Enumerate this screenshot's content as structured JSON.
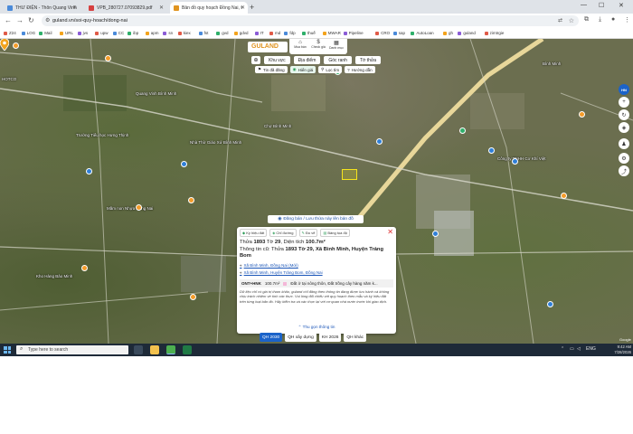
{
  "browser": {
    "tabs": [
      {
        "title": "THƯ ĐIỆN - Thôn Quang Vinh",
        "active": false
      },
      {
        "title": "VPB_280727.07093829.pdf",
        "active": false
      },
      {
        "title": "Bản đồ quy hoạch Đồng Nai, t",
        "active": true
      }
    ],
    "url": "guland.vn/soi-quy-hoach/dong-nai",
    "bookmarks": [
      "Z24",
      "LOG",
      "Mail",
      "URL",
      "jvs",
      "upw",
      "CC",
      "ibp",
      "apm",
      "sn",
      "kiex",
      "fst",
      "gvd",
      "gdvd",
      "IT",
      "md",
      "fdp",
      "thuế",
      "MWAR",
      "Pipeline",
      "CRO",
      "sap",
      "AutoLoan",
      "gh",
      "guland",
      "zimtrgie"
    ]
  },
  "map": {
    "brand": "GULAND",
    "top_icons": [
      {
        "icon": "house-icon",
        "label": "Mua bán"
      },
      {
        "icon": "dollar-icon",
        "label": "Check giá"
      },
      {
        "icon": "grid-icon",
        "label": "Danh mục"
      }
    ],
    "filters1": [
      "Khu vực",
      "Địa điểm",
      "Góc ranh",
      "Tờ thửa"
    ],
    "filters2": [
      "Tin đã đăng",
      "Hiển giá",
      "Lọc tìm",
      "Hướng dẫn"
    ],
    "places": [
      "Trường Tiểu học Hưng Thịnh",
      "Mầm non Nhựa Đồng Nai",
      "Nhà Thờ Giáo Xứ Bình Minh",
      "Chợ Bình Minh",
      "Công ty TNHH Cơ Khí Việt",
      "Quang Vinh Bình Minh",
      "Kho Hàng Bảo Minh",
      "HOTCO",
      "Bình Minh"
    ],
    "register_button": "Đăng bán / Lưu thửa này lên bản đồ",
    "bottom_tabs": [
      "QH 2030",
      "QH xây dựng",
      "KH 2026",
      "QH khác"
    ],
    "active_bottom_tab": "QH 2030",
    "google_mark": "Google"
  },
  "parcel_card": {
    "chips": [
      "Ký hiệu đất",
      "Chỉ đường",
      "Đo vẽ",
      "Bảng tọa độ"
    ],
    "line1_prefix": "Thửa ",
    "parcel_no": "1893",
    "line1_mid": " Tờ ",
    "sheet_no": "29",
    "line1_area_label": ", Diện tích ",
    "area": "100.7m²",
    "line2_prefix": "Thông tin cũ: Thửa ",
    "line2_rest": " Tờ 29, Xã Bình Minh, Huyện Trảng Bom",
    "loc1": "Xã Bình Minh, Đồng Nai (Mới)",
    "loc2": "Xã Bình Minh, Huyện Trảng Bom, Đồng Nai",
    "land_code": "ONT+HNK",
    "land_area": "100.7m²",
    "land_desc": "Đất ở tại nông thôn, Đất trồng cây hàng năm k...",
    "disclaimer": "Dữ liệu chỉ có giá trị tham khảo, guland chỉ đăng theo thông tin đang được lưu hành và không chịu trách nhiệm về tính xác thực. Vui lòng đối chiếu với quy hoạch theo mẫu và ký hiệu đất trên từng loại bản đồ. Hãy kiểm tra và xác thực lại với cơ quan nhà nước trước khi giao dịch.",
    "collapse": "Thu gọn thông tin"
  },
  "taskbar": {
    "search_placeholder": "Type here to search",
    "lang": "ENG",
    "time": "9:42 AM",
    "date": "7/28/2026"
  },
  "colors": {
    "brand_orange": "#e09420",
    "link_blue": "#1b56b8",
    "active_tab_blue": "#1b63c9",
    "close_red": "#d33333"
  }
}
